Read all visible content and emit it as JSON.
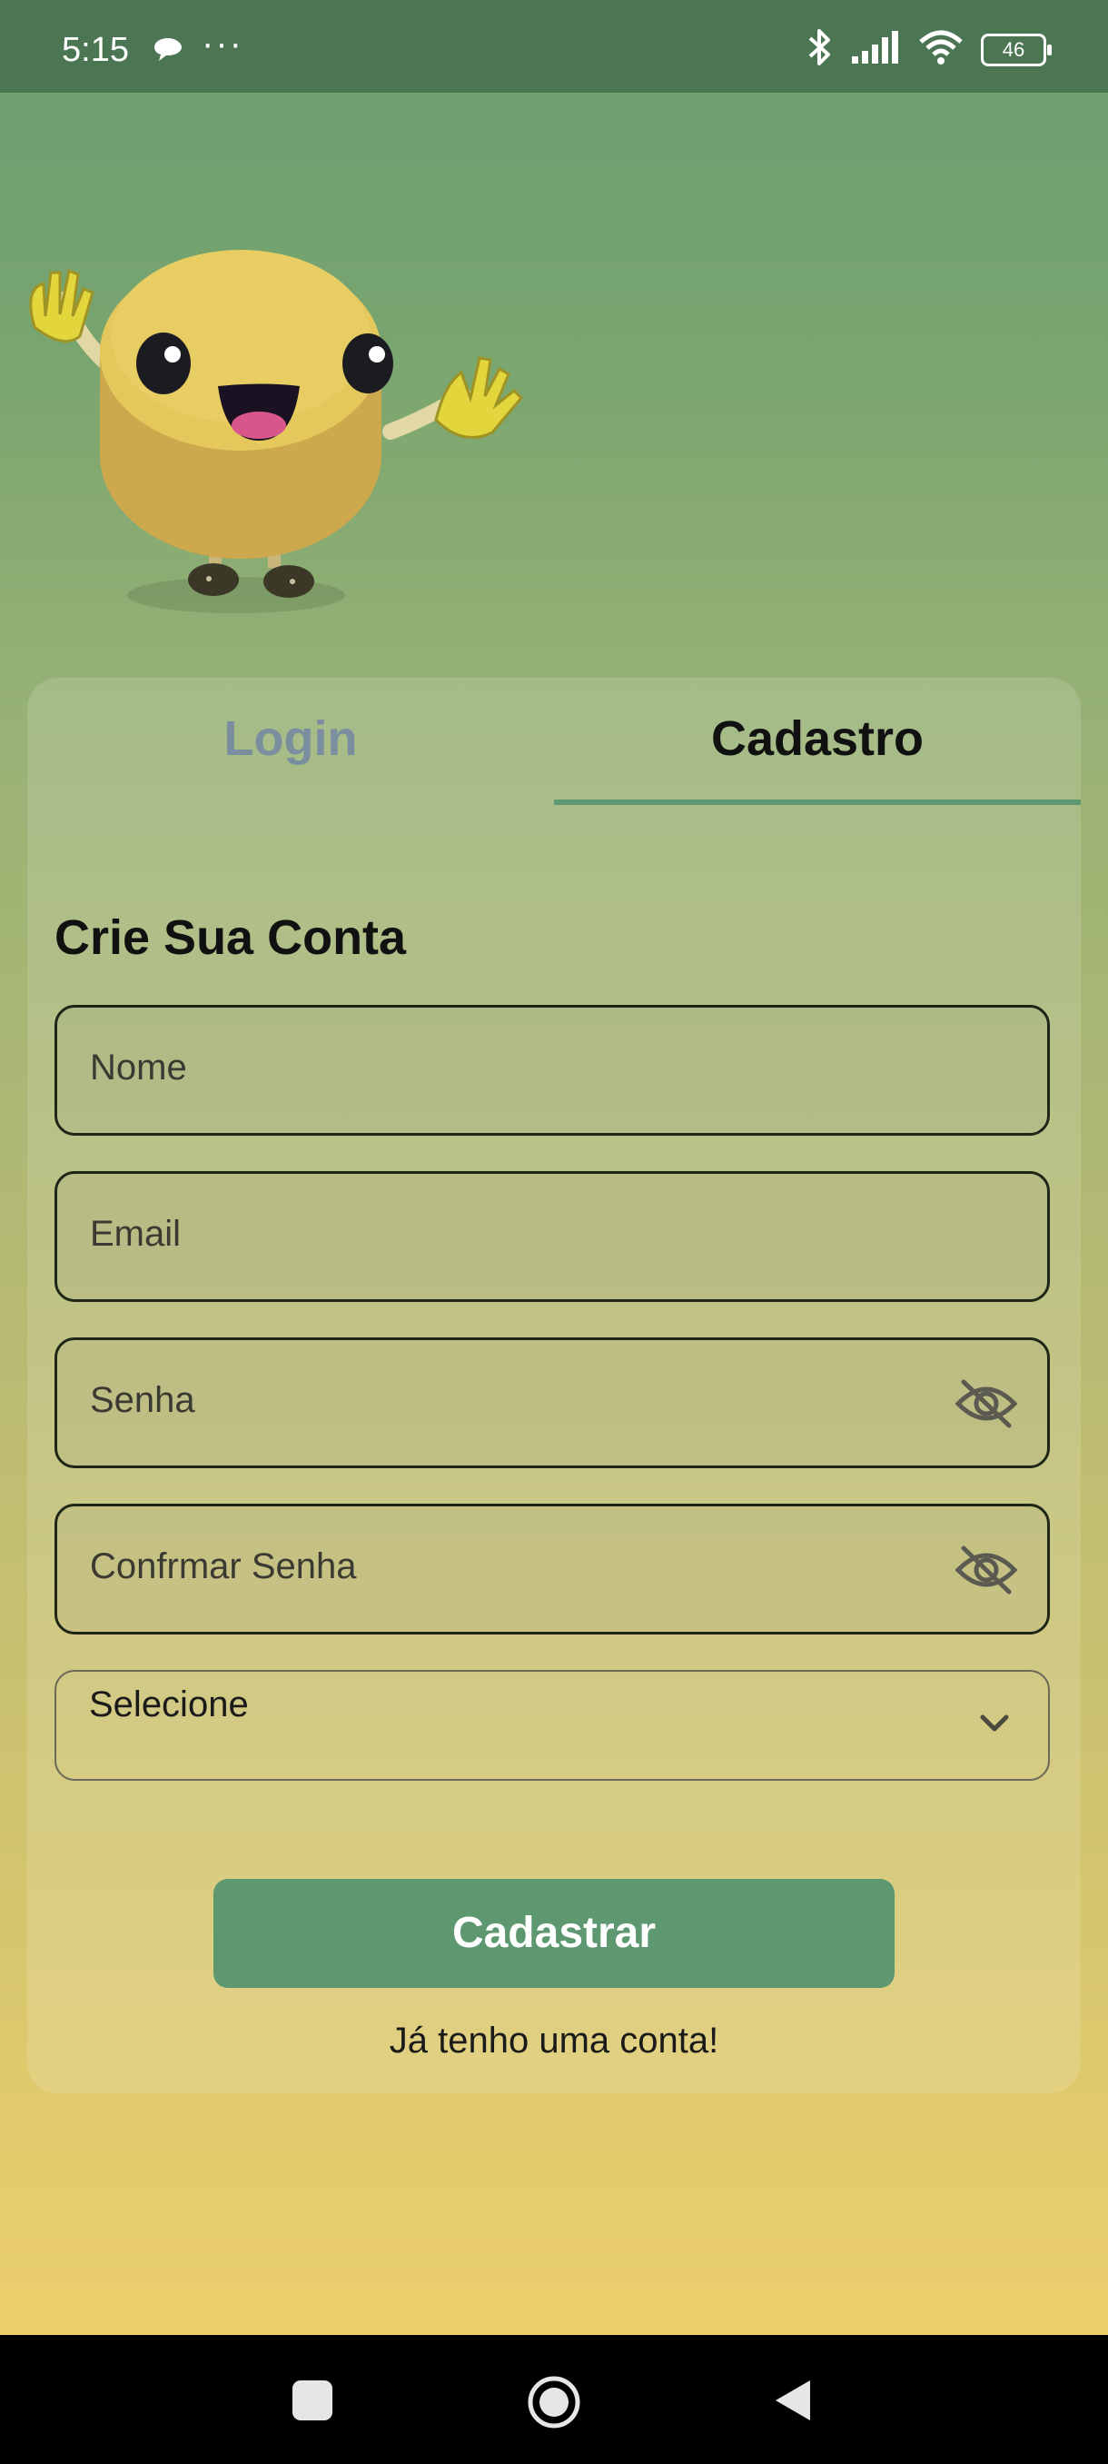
{
  "status_bar": {
    "time": "5:15",
    "dots": "···",
    "battery": "46"
  },
  "tabs": [
    {
      "label": "Login",
      "active": false
    },
    {
      "label": "Cadastro",
      "active": true
    }
  ],
  "form": {
    "title": "Crie Sua Conta",
    "fields": {
      "name": "Nome",
      "email": "Email",
      "password": "Senha",
      "confirm_password": "Confrmar Senha"
    },
    "select": {
      "value": "Selecione"
    },
    "submit_label": "Cadastrar",
    "have_account_link": "Já tenho uma conta!"
  },
  "colors": {
    "accent": "#5e9870",
    "status_bar": "#4b7553",
    "nav_bar": "#000000"
  },
  "icons": [
    "chat-bubble-icon",
    "bluetooth-icon",
    "signal-icon",
    "wifi-icon",
    "battery-icon",
    "eye-off-icon",
    "chevron-down-icon",
    "nav-recents-icon",
    "nav-home-icon",
    "nav-back-icon"
  ]
}
